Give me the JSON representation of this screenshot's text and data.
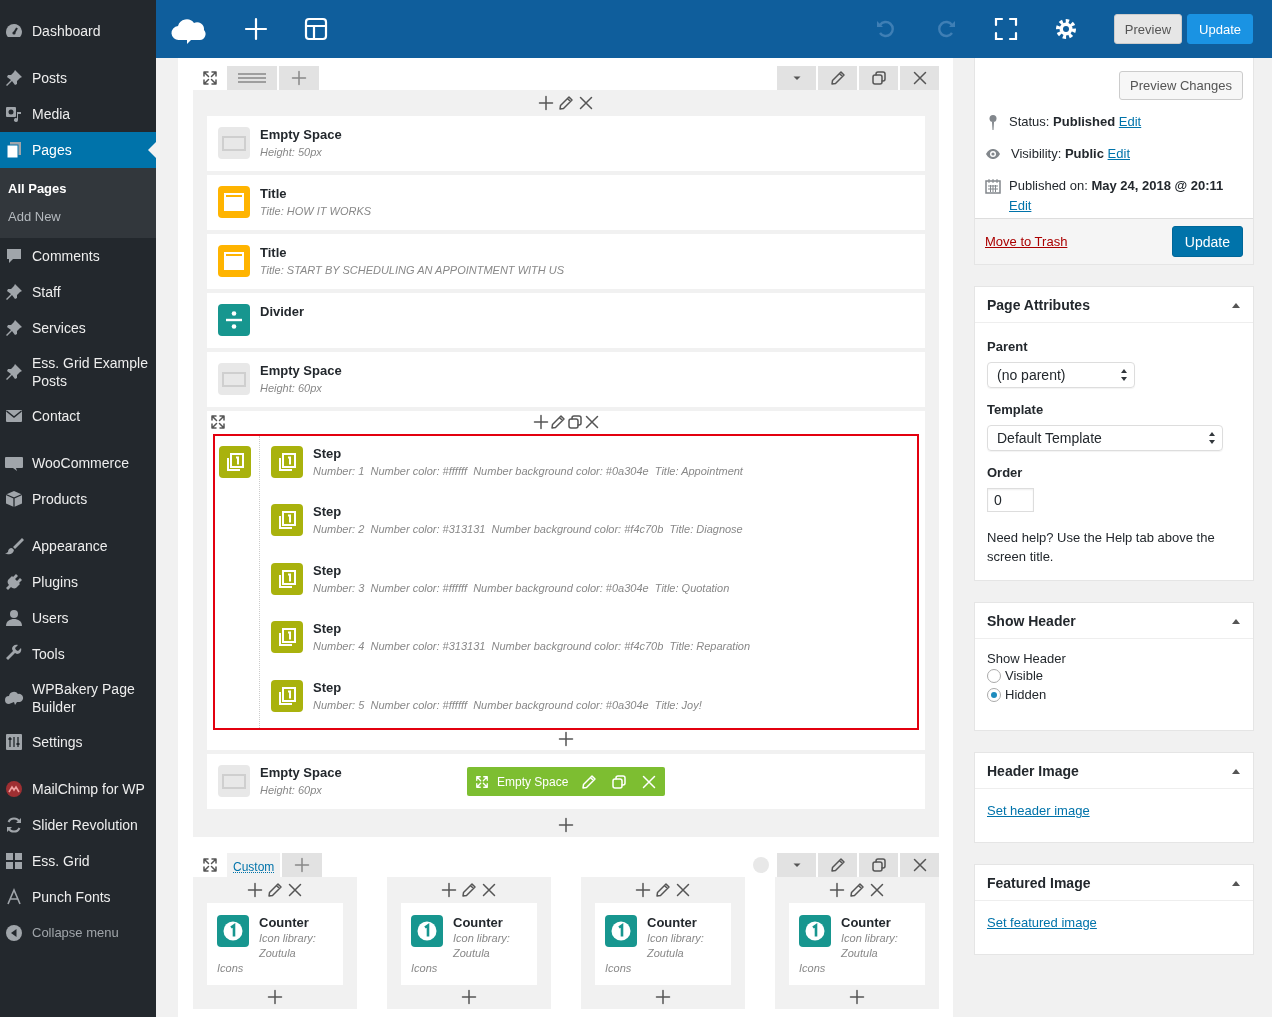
{
  "sidebar": {
    "groups": [
      [
        {
          "label": "Dashboard",
          "selected": false
        }
      ],
      [
        {
          "label": "Posts",
          "selected": false
        },
        {
          "label": "Media",
          "selected": false
        },
        {
          "label": "Pages",
          "selected": true,
          "submenu": [
            {
              "label": "All Pages",
              "selected": true
            },
            {
              "label": "Add New",
              "selected": false
            }
          ]
        },
        {
          "label": "Comments",
          "selected": false
        },
        {
          "label": "Staff",
          "selected": false
        },
        {
          "label": "Services",
          "selected": false
        },
        {
          "label": "Ess. Grid Example Posts",
          "selected": false
        },
        {
          "label": "Contact",
          "selected": false
        }
      ],
      [
        {
          "label": "WooCommerce",
          "selected": false
        },
        {
          "label": "Products",
          "selected": false
        }
      ],
      [
        {
          "label": "Appearance",
          "selected": false
        },
        {
          "label": "Plugins",
          "selected": false
        },
        {
          "label": "Users",
          "selected": false
        },
        {
          "label": "Tools",
          "selected": false
        },
        {
          "label": "WPBakery Page Builder",
          "selected": false
        },
        {
          "label": "Settings",
          "selected": false
        }
      ],
      [
        {
          "label": "MailChimp for WP",
          "selected": false
        },
        {
          "label": "Slider Revolution",
          "selected": false
        },
        {
          "label": "Ess. Grid",
          "selected": false
        },
        {
          "label": "Punch Fonts",
          "selected": false
        }
      ]
    ],
    "collapse_label": "Collapse menu"
  },
  "toolbar": {
    "history": [
      {
        "kind": "undo",
        "disabled": true
      },
      {
        "kind": "redo",
        "disabled": true
      }
    ],
    "buttons": [
      {
        "label": "Preview",
        "kind": "secondary"
      },
      {
        "label": "Update",
        "kind": "primary"
      }
    ]
  },
  "builder": {
    "row_1": {
      "elements": [
        {
          "kind": "empty",
          "title": "Empty Space",
          "detail": "Height: 50px"
        },
        {
          "kind": "title",
          "title": "Title",
          "detail": "Title: HOW IT WORKS"
        },
        {
          "kind": "title",
          "title": "Title",
          "detail": "Title: START BY SCHEDULING AN APPOINTMENT WITH US"
        },
        {
          "kind": "divider",
          "title": "Divider"
        },
        {
          "kind": "empty",
          "title": "Empty Space",
          "detail": "Height: 60px"
        },
        {
          "kind": "steps",
          "highlighted": true,
          "steps": [
            {
              "title": "Step",
              "detail": "Number: 1  Number color: #ffffff  Number background color: #0a304e  Title: Appointment"
            },
            {
              "title": "Step",
              "detail": "Number: 2  Number color: #313131  Number background color: #f4c70b  Title: Diagnose"
            },
            {
              "title": "Step",
              "detail": "Number: 3  Number color: #ffffff  Number background color: #0a304e  Title: Quotation"
            },
            {
              "title": "Step",
              "detail": "Number: 4  Number color: #313131  Number background color: #f4c70b  Title: Reparation"
            },
            {
              "title": "Step",
              "detail": "Number: 5  Number color: #ffffff  Number background color: #0a304e  Title: Joy!"
            }
          ]
        },
        {
          "kind": "empty",
          "title": "Empty Space",
          "detail": "Height: 60px",
          "hover_label": "Empty Space"
        }
      ]
    },
    "row_2": {
      "tab": "Custom",
      "columns": [
        {
          "title": "Counter",
          "detail": "Icon library: Zoutula Icons"
        },
        {
          "title": "Counter",
          "detail": "Icon library: Zoutula Icons"
        },
        {
          "title": "Counter",
          "detail": "Icon library: Zoutula Icons"
        },
        {
          "title": "Counter",
          "detail": "Icon library: Zoutula Icons"
        }
      ]
    }
  },
  "publish": {
    "preview_button": "Preview Changes",
    "lines": [
      {
        "kind": "status",
        "text": "Status: **Published**",
        "link": "Edit"
      },
      {
        "kind": "visibility",
        "text": "Visibility: **Public**",
        "link": "Edit"
      },
      {
        "kind": "date",
        "text": "Published on: **May 24, 2018 @ 20:11**",
        "link": "Edit"
      }
    ],
    "trash_link": "Move to Trash",
    "update_button": "Update"
  },
  "page_attributes": {
    "title": "Page Attributes",
    "parent_label": "Parent",
    "parent_value": "(no parent)",
    "template_label": "Template",
    "template_value": "Default Template",
    "order_label": "Order",
    "order_value": "0",
    "help": "Need help? Use the Help tab above the screen title."
  },
  "show_header": {
    "title": "Show Header",
    "label": "Show Header",
    "options": [
      {
        "label": "Visible",
        "selected": false
      },
      {
        "label": "Hidden",
        "selected": true
      }
    ]
  },
  "header_image": {
    "title": "Header Image",
    "link": "Set header image"
  },
  "featured_image": {
    "title": "Featured Image",
    "link": "Set featured image"
  }
}
